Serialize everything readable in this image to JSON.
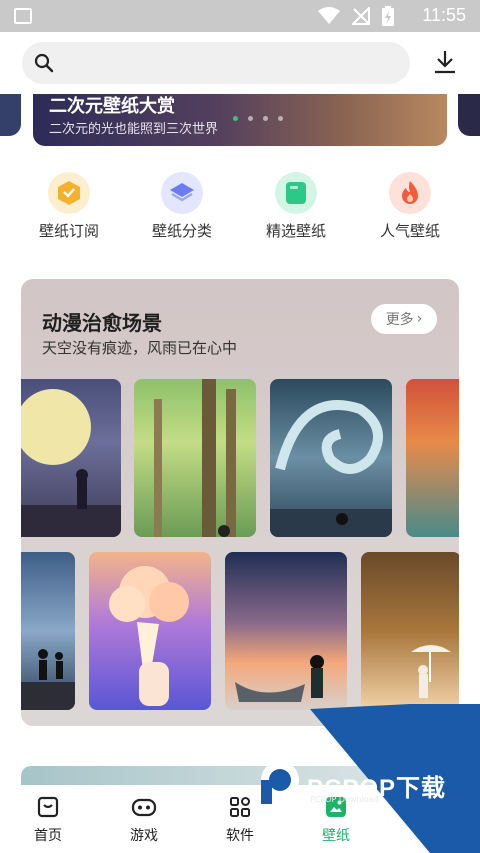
{
  "status_bar": {
    "time": "11:55"
  },
  "search": {
    "placeholder": ""
  },
  "banner": {
    "title": "二次元壁纸大赏",
    "subtitle": "二次元的光也能照到三次世界",
    "dots": 4,
    "active_dot": 0
  },
  "quick_links": [
    {
      "label": "壁纸订阅",
      "icon": "subscribe-icon",
      "color": "#f5b12e"
    },
    {
      "label": "壁纸分类",
      "icon": "category-icon",
      "color": "#6c7cf2"
    },
    {
      "label": "精选壁纸",
      "icon": "featured-icon",
      "color": "#2cc887"
    },
    {
      "label": "人气壁纸",
      "icon": "popular-icon",
      "color": "#f55a3a"
    }
  ],
  "section": {
    "title": "动漫治愈场景",
    "subtitle": "天空没有痕迹，风雨已在心中",
    "more_label": "更多"
  },
  "tabs": [
    {
      "label": "首页",
      "icon": "home-icon"
    },
    {
      "label": "游戏",
      "icon": "gamepad-icon"
    },
    {
      "label": "软件",
      "icon": "apps-icon"
    },
    {
      "label": "壁纸",
      "icon": "wallpaper-icon",
      "active": true
    }
  ],
  "watermark": {
    "brand": "PCPOP下载",
    "sub": "PCPOP Download"
  },
  "colors": {
    "accent": "#1fb36a",
    "watermark_blue": "#1b5aa8"
  }
}
